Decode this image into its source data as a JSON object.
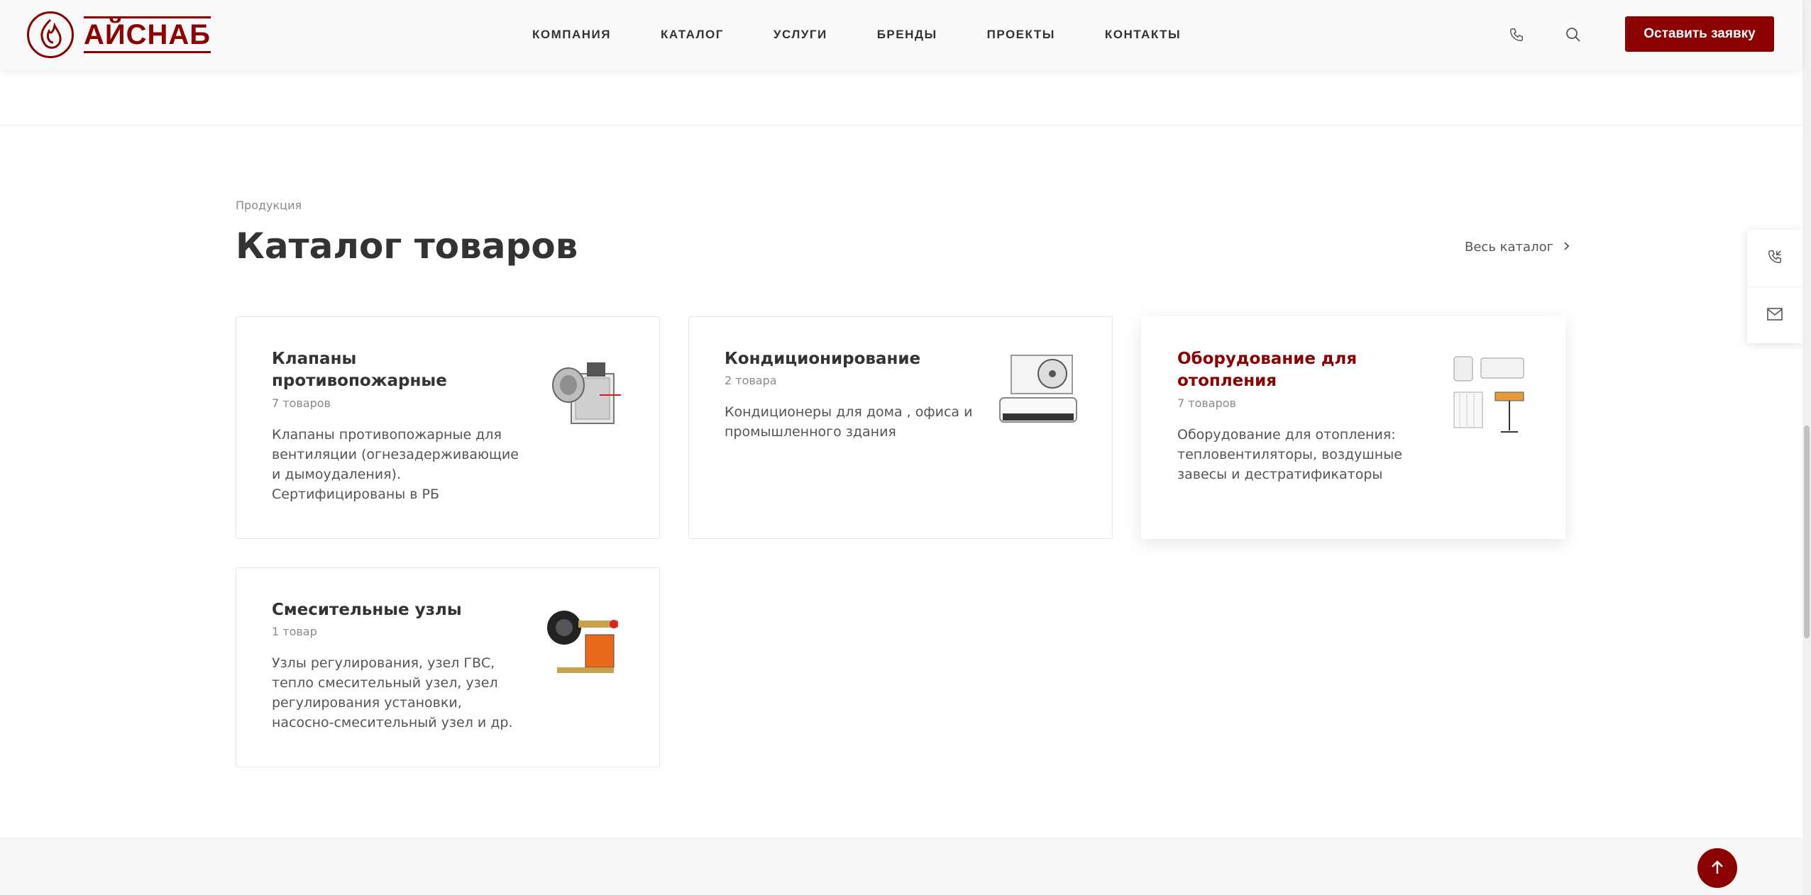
{
  "header": {
    "logo_text": "АЙСНАБ",
    "nav": [
      "КОМПАНИЯ",
      "КАТАЛОГ",
      "УСЛУГИ",
      "БРЕНДЫ",
      "ПРОЕКТЫ",
      "КОНТАКТЫ"
    ],
    "cta_label": "Оставить заявку",
    "icons": [
      "phone-icon",
      "search-icon"
    ]
  },
  "section": {
    "tag": "Продукция",
    "title": "Каталог товаров",
    "all_link": "Весь каталог"
  },
  "cards": [
    {
      "title": "Клапаны противопожарные",
      "count": "7 товаров",
      "description": "Клапаны противопожарные для вентиляции (огнезадерживающие и дымоудаления). Сертифицированы в РБ"
    },
    {
      "title": "Кондиционирование",
      "count": "2 товара",
      "description": "Кондиционеры для дома , офиса и промышленного здания"
    },
    {
      "title": "Оборудование для отопления",
      "count": "7 товаров",
      "description": "Оборудование для отопления: тепловентиляторы, воздушные завесы и дестратификаторы"
    },
    {
      "title": "Смесительные узлы",
      "count": "1 товар",
      "description": "Узлы регулирования, узел ГВС, тепло смесительный узел, узел регулирования установки, насосно-смесительный узел и др."
    }
  ],
  "colors": {
    "brand": "#8b0000",
    "text": "#333333",
    "muted": "#8a8a8a"
  }
}
